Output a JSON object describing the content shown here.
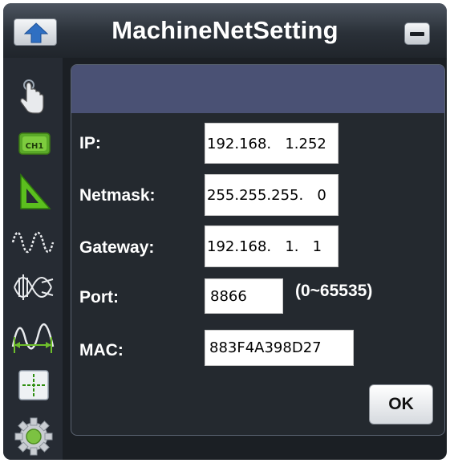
{
  "window": {
    "title": "MachineNetSetting"
  },
  "sidebar": {
    "items": [
      {
        "icon": "touch-hand-icon"
      },
      {
        "icon": "channel-ch1-icon",
        "label": "CH1"
      },
      {
        "icon": "triangle-ruler-icon"
      },
      {
        "icon": "sine-wave-icon"
      },
      {
        "icon": "fft-signal-icon"
      },
      {
        "icon": "wave-measure-icon"
      },
      {
        "icon": "crosshair-cursor-icon"
      },
      {
        "icon": "gear-icon"
      }
    ]
  },
  "form": {
    "ip": {
      "label": "IP:",
      "value": "192.168.   1.252"
    },
    "netmask": {
      "label": "Netmask:",
      "value": "255.255.255.   0"
    },
    "gateway": {
      "label": "Gateway:",
      "value": "192.168.   1.   1"
    },
    "port": {
      "label": "Port:",
      "value": "8866",
      "range": "(0~65535)"
    },
    "mac": {
      "label": "MAC:",
      "value": "883F4A398D27"
    },
    "ok_label": "OK"
  },
  "colors": {
    "panel_header": "#4a5174",
    "background": "#1b1f24",
    "accent_green": "#6fbf2c"
  }
}
